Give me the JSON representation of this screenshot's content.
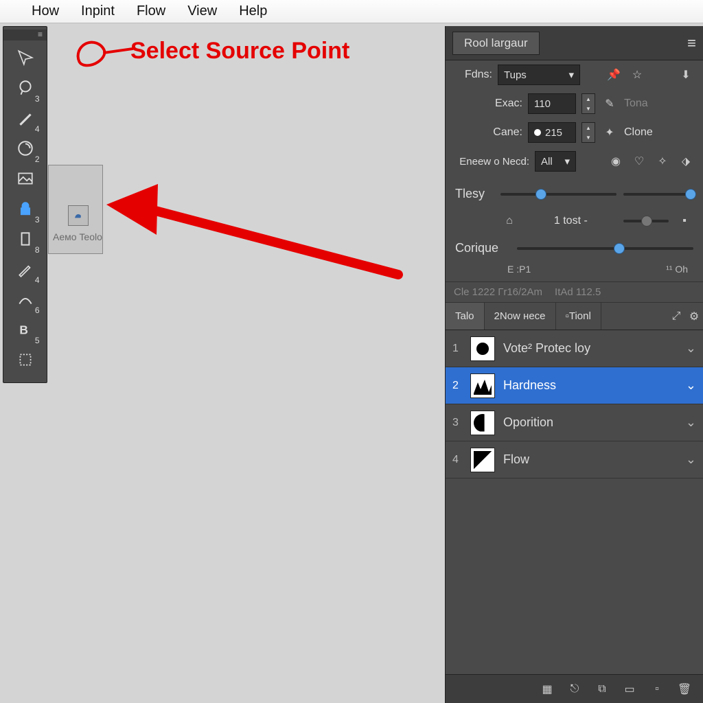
{
  "menubar": {
    "items": [
      "How",
      "Inpint",
      "Flow",
      "View",
      "Help"
    ]
  },
  "annotation": {
    "label": "Select Source Point"
  },
  "flyout": {
    "label": "Aемо Teolo"
  },
  "toolbox": {
    "tools": [
      {
        "name": "arrow-tool",
        "badge": ""
      },
      {
        "name": "lasso-tool",
        "badge": "3"
      },
      {
        "name": "brush-tool",
        "badge": "4"
      },
      {
        "name": "clone-tool",
        "badge": "2"
      },
      {
        "name": "image-tool",
        "badge": ""
      },
      {
        "name": "lock-tool",
        "badge": "3",
        "active": true
      },
      {
        "name": "bucket-tool",
        "badge": "8"
      },
      {
        "name": "pencil-tool",
        "badge": "4"
      },
      {
        "name": "path-tool",
        "badge": "6"
      },
      {
        "name": "text-tool",
        "badge": "5"
      },
      {
        "name": "crop-tool",
        "badge": ""
      }
    ]
  },
  "panel": {
    "title": "Rool largaur",
    "fdns": {
      "label": "Fdns:",
      "value": "Tups"
    },
    "exec": {
      "label": "Exac:",
      "value": "110",
      "side": "Tona"
    },
    "cane": {
      "label": "Cane:",
      "value": "215",
      "side": "Clone"
    },
    "eneew": {
      "label": "Eneew o Necd:",
      "value": "All"
    },
    "slider1_label": "Tlesy",
    "tost": "1 tost -",
    "corique": "Corique",
    "ep": "E :P1",
    "oh": "¹¹ Oh",
    "status": {
      "a": "Cle 1222 Гr16/2Am",
      "b": "ItAd 112.5"
    },
    "tabs2": {
      "a": "Talo",
      "b": "2Now нece",
      "c": "Tionl"
    },
    "layers": [
      {
        "n": "1",
        "name": "Vote² Protec loy"
      },
      {
        "n": "2",
        "name": "Hardness",
        "sel": true
      },
      {
        "n": "3",
        "name": "Oporition"
      },
      {
        "n": "4",
        "name": "Flow"
      }
    ]
  }
}
